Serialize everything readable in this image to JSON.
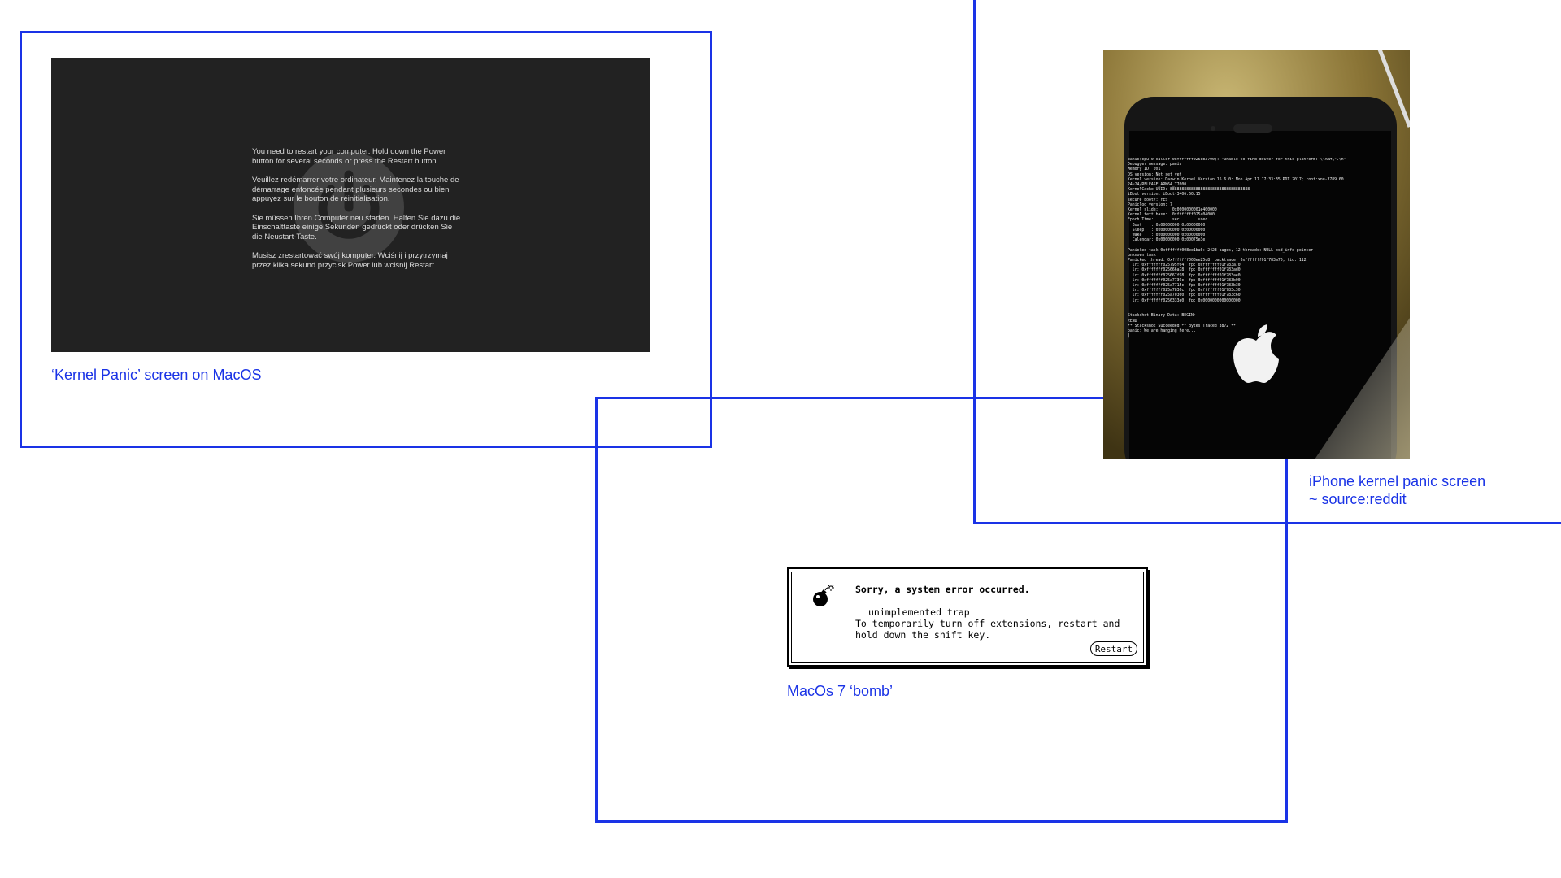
{
  "captions": {
    "macos": "‘Kernel Panic’ screen on MacOS",
    "iphone": "iPhone kernel panic screen\n~ source:reddit",
    "bomb": "MacOs 7 ‘bomb’"
  },
  "macos_panic": {
    "paragraphs": [
      "You need to restart your computer. Hold down the Power button for several seconds or press the Restart button.",
      "Veuillez redémarrer votre ordinateur. Maintenez la touche de démarrage enfoncée pendant plusieurs secondes ou bien appuyez sur le bouton de réinitialisation.",
      "Sie müssen Ihren Computer neu starten. Halten Sie dazu die Einschalttaste einige Sekunden gedrückt oder drücken Sie die Neustart-Taste.",
      "Musisz zrestartować swój komputer. Wciśnij i przytrzymaj przez kilka sekund przycisk Power lub wciśnij Restart."
    ]
  },
  "iphone_panic": {
    "console": "panic(cpu 0 caller 0xfffffff025eb3700): \"Unable to find driver for this platform: \\\"ARM\\\".\\n\"\nDebugger message: panic\nMemory ID: 0x1\nOS version: Not set yet\nKernel version: Darwin Kernel Version 16.6.0: Mon Apr 17 17:33:35 PDT 2017; root:xnu-3789.60.\n24~24/RELEASE_ARM64_T7000\nKernelCache UUID: 8888888888888888888888888888888888\niBoot version: iBoot-3406.60.15\nsecure boot?: YES\nPaniclog version: 7\nKernel slide:      0x0000000001e400000\nKernel text base:  0xfffffff025a04000\nEpoch Time:        sec        usec\n  Boot    : 0x00000000 0x00000000\n  Sleep   : 0x00000000 0x00000000\n  Wake    : 0x00000000 0x00000000\n  Calendar: 0x00000000 0x00075e3e\n\nPanicked task 0xfffffff008ee1ba0: 2423 pages, 12 threads: NULL bsd_info pointer\nunknown task\nPanicked thread: 0xfffffff008ee25c8, backtrace: 0xfffffff01f783a70, tid: 112\n  lr: 0xfffffff025795f04  fp: 0xfffffff01f783a70\n  lr: 0xfffffff025666a78  fp: 0xfffffff01f783ad0\n  lr: 0xfffffff025667f98  fp: 0xfffffff01f783ae0\n  lr: 0xfffffff025a7739c  fp: 0xfffffff01f783b00\n  lr: 0xfffffff025a7715c  fp: 0xfffffff01f783b30\n  lr: 0xfffffff025a7836c  fp: 0xfffffff01f783c30\n  lr: 0xfffffff025a70360  fp: 0xfffffff01f783c60\n  lr: 0xfffffff0256333e0  fp: 0x0000000000000000\n\n\nStackshot Binary Data: BEGIN>\n<END\n** Stackshot Succeeded ** Bytes Traced 3872 **\npanic: We are hanging here...\n▌"
  },
  "bomb_dialog": {
    "title": "Sorry, a system error occurred.",
    "error": "unimplemented trap",
    "instructions": "To temporarily turn off extensions, restart and\nhold down the shift key.",
    "restart_label": "Restart"
  }
}
